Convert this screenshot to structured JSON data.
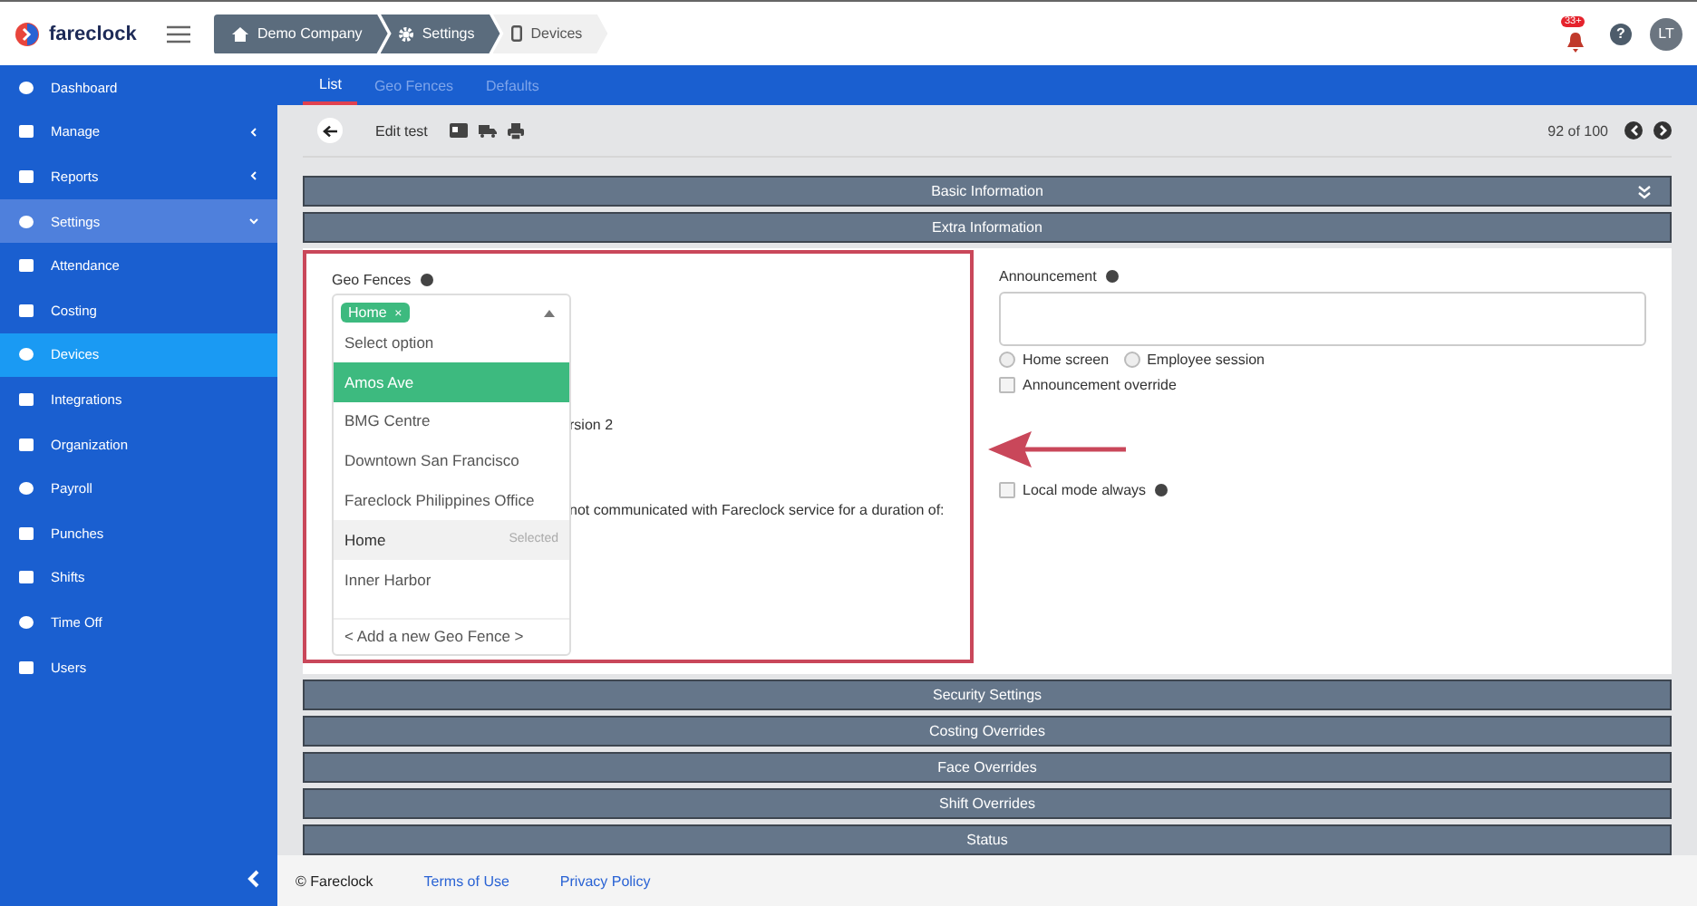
{
  "header": {
    "logo_text": "fareclock",
    "breadcrumb": [
      {
        "label": "Demo Company",
        "selected": false
      },
      {
        "label": "Settings",
        "selected": false
      },
      {
        "label": "Devices",
        "selected": true
      }
    ],
    "notification_badge": "33+",
    "help": "?",
    "avatar": "LT"
  },
  "sidebar": {
    "items": [
      {
        "label": "Dashboard",
        "kind": "link",
        "selected": false
      },
      {
        "label": "Manage",
        "kind": "group",
        "expanded": false,
        "selected": false
      },
      {
        "label": "Reports",
        "kind": "group",
        "expanded": false,
        "selected": false
      },
      {
        "label": "Settings",
        "kind": "group",
        "expanded": true,
        "selected": false
      },
      {
        "label": "Attendance",
        "kind": "link",
        "selected": false
      },
      {
        "label": "Costing",
        "kind": "link",
        "selected": false
      },
      {
        "label": "Devices",
        "kind": "link",
        "selected": true
      },
      {
        "label": "Integrations",
        "kind": "link",
        "selected": false
      },
      {
        "label": "Organization",
        "kind": "link",
        "selected": false
      },
      {
        "label": "Payroll",
        "kind": "link",
        "selected": false
      },
      {
        "label": "Punches",
        "kind": "link",
        "selected": false
      },
      {
        "label": "Shifts",
        "kind": "link",
        "selected": false
      },
      {
        "label": "Time Off",
        "kind": "link",
        "selected": false
      },
      {
        "label": "Users",
        "kind": "link",
        "selected": false
      }
    ]
  },
  "tabs": [
    {
      "label": "List",
      "selected": true
    },
    {
      "label": "Geo Fences",
      "selected": false
    },
    {
      "label": "Defaults",
      "selected": false
    }
  ],
  "toolbar": {
    "title": "Edit test",
    "pager": "92 of 100"
  },
  "sections_top": [
    {
      "title": "Basic Information",
      "toggle": true
    },
    {
      "title": "Extra Information",
      "toggle": false
    }
  ],
  "extra": {
    "geo_fences": {
      "label": "Geo Fences",
      "tag": "Home",
      "tag_remove": "×",
      "options": [
        {
          "label": "Select option",
          "highlighted": false,
          "selected": false
        },
        {
          "label": "Amos Ave",
          "highlighted": true,
          "selected": false
        },
        {
          "label": "BMG Centre",
          "highlighted": false,
          "selected": false
        },
        {
          "label": "Downtown San Francisco",
          "highlighted": false,
          "selected": false
        },
        {
          "label": "Fareclock Philippines Office",
          "highlighted": false,
          "selected": false
        },
        {
          "label": "Home",
          "highlighted": false,
          "selected": true,
          "note": "Selected"
        },
        {
          "label": "Inner Harbor",
          "highlighted": false,
          "selected": false
        }
      ],
      "add_option": "< Add a new Geo Fence >"
    },
    "hidden_texts": [
      "rsion 2",
      "not communicated with Fareclock service for a duration of:"
    ],
    "announcement": {
      "label": "Announcement",
      "radios": [
        {
          "label": "Home screen",
          "selected": false
        },
        {
          "label": "Employee session",
          "selected": false
        }
      ],
      "override": {
        "label": "Announcement override",
        "checked": false
      }
    },
    "local_mode": {
      "label": "Local mode always",
      "checked": false
    }
  },
  "sections_bottom": [
    "Security Settings",
    "Costing Overrides",
    "Face Overrides",
    "Shift Overrides",
    "Status"
  ],
  "footer": {
    "copyright": "© Fareclock",
    "links": [
      "Terms of Use",
      "Privacy Policy"
    ]
  }
}
